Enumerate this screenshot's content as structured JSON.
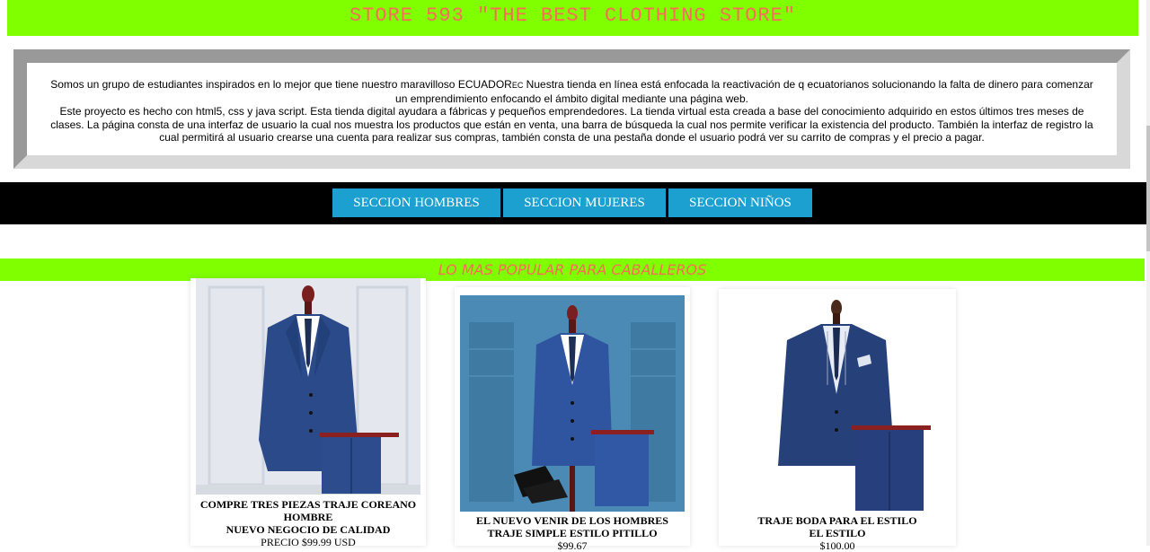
{
  "header": {
    "title": "STORE 593 \"THE BEST CLOTHING STORE\""
  },
  "about": {
    "line1_pre": "Somos un grupo de estudiantes inspirados en lo mejor que tiene nuestro maravilloso ECUADOR",
    "line1_ec": "EC",
    "line1_post": " Nuestra tienda en línea está enfocada la reactivación de q ecuatorianos solucionando la falta de dinero para comenzar un emprendimiento enfocando el ámbito digital mediante una página web.",
    "line2": "Este proyecto es hecho con html5, css y java script. Esta tienda digital ayudara a fábricas y pequeños emprendedores. La tienda virtual esta creada a base del conocimiento adquirido en estos últimos tres meses de clases. La página consta de una interfaz de usuario la cual nos muestra los productos que están en venta, una barra de búsqueda la cual nos permite verificar la existencia del producto. También la interfaz de registro la cual permitirá al usuario crearse una cuenta para realizar sus compras, también consta de una pestaña donde el usuario podrá ver su carrito de compras y el precio a pagar."
  },
  "nav": {
    "men": "SECCION HOMBRES",
    "women": "SECCION MUJERES",
    "kids": "SECCION NIÑOS"
  },
  "popular": {
    "title": "LO MAS POPULAR PARA CABALLEROS"
  },
  "products": [
    {
      "title1": "COMPRE TRES PIEZAS TRAJE COREANO",
      "title2": "HOMBRE",
      "title3": "NUEVO NEGOCIO DE CALIDAD",
      "price": "PRECIO $99.99 USD"
    },
    {
      "title1": "EL NUEVO VENIR DE LOS HOMBRES",
      "title2": "TRAJE SIMPLE ESTILO PITILLO",
      "price": "$99.67"
    },
    {
      "title1": "TRAJE BODA PARA EL ESTILO",
      "title2": "EL ESTILO",
      "price": "$100.00"
    }
  ],
  "colors": {
    "header_bg": "#7fff00",
    "title_text": "#ff6a5a",
    "nav_button": "#1ba0d0",
    "suit_navy": "#2a4a8a"
  }
}
